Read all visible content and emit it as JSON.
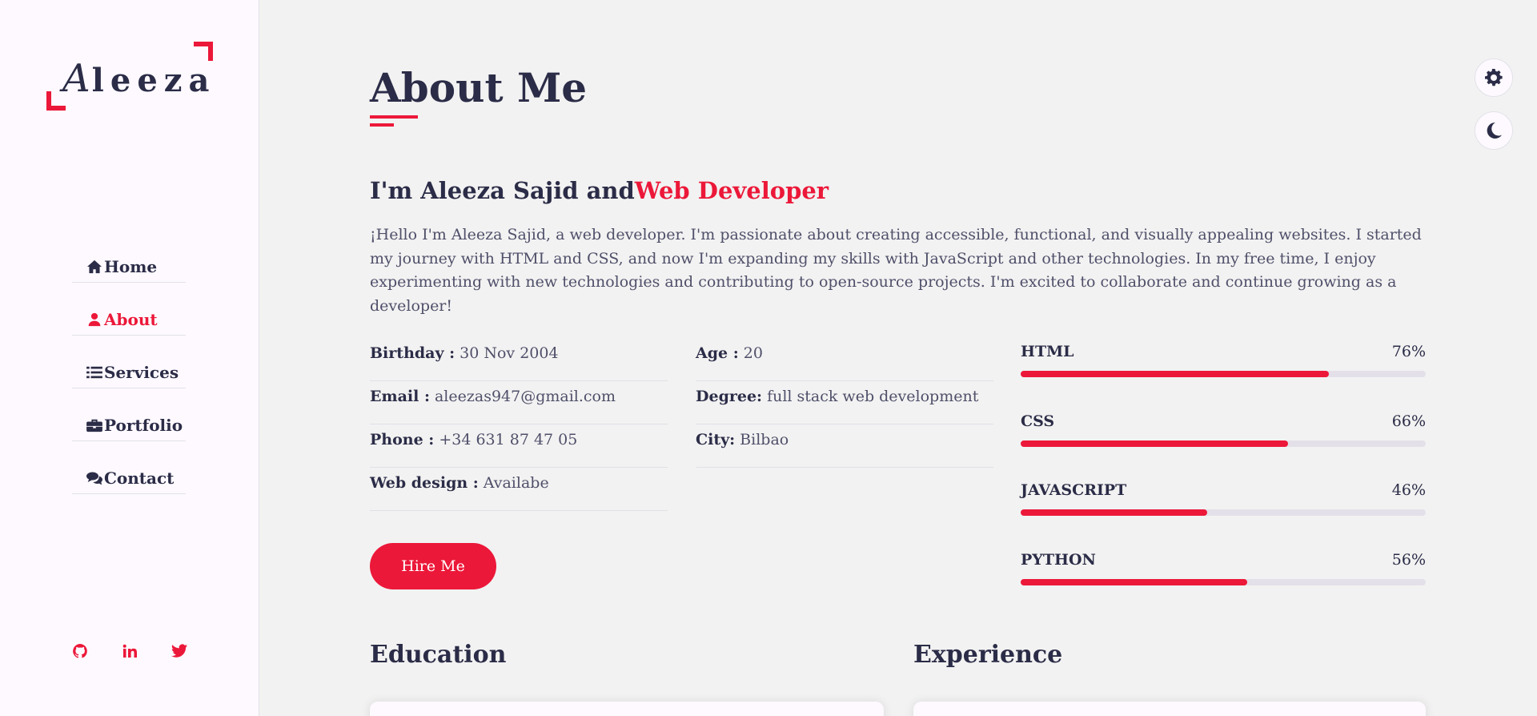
{
  "brand": {
    "logo_first": "A",
    "logo_rest": "leeza"
  },
  "nav": {
    "items": [
      {
        "label": "Home",
        "icon": "home-icon"
      },
      {
        "label": "About",
        "icon": "user-icon",
        "active": true
      },
      {
        "label": "Services",
        "icon": "list-icon"
      },
      {
        "label": "Portfolio",
        "icon": "briefcase-icon"
      },
      {
        "label": "Contact",
        "icon": "comments-icon"
      }
    ]
  },
  "socials": [
    "github-icon",
    "linkedin-icon",
    "twitter-icon"
  ],
  "toggles": [
    "gear-icon",
    "moon-icon"
  ],
  "about": {
    "title": "About Me",
    "heading_prefix": "I'm Aleeza Sajid and",
    "heading_accent": "Web Developer",
    "intro": "¡Hello I'm Aleeza Sajid, a web developer. I'm passionate about creating accessible, functional, and visually appealing websites. I started my journey with HTML and CSS, and now I'm expanding my skills with JavaScript and other technologies. In my free time, I enjoy experimenting with new technologies and contributing to open-source projects. I'm excited to collaborate and continue growing as a developer!",
    "info_left": [
      {
        "label": "Birthday :",
        "value": "30 Nov 2004"
      },
      {
        "label": "Email :",
        "value": "aleezas947@gmail.com"
      },
      {
        "label": "Phone :",
        "value": "+34 631 87 47 05"
      },
      {
        "label": "Web design :",
        "value": "Availabe"
      }
    ],
    "info_right": [
      {
        "label": "Age :",
        "value": "20"
      },
      {
        "label": "Degree:",
        "value": "full stack web development"
      },
      {
        "label": "City:",
        "value": "Bilbao"
      }
    ],
    "hire_label": "Hire Me",
    "skills": [
      {
        "name": "HTML",
        "percent_label": "76%",
        "value": 76
      },
      {
        "name": "CSS",
        "percent_label": "66%",
        "value": 66
      },
      {
        "name": "JAVASCRIPT",
        "percent_label": "46%",
        "value": 46
      },
      {
        "name": "PYTHON",
        "percent_label": "56%",
        "value": 56
      }
    ],
    "education_title": "Education",
    "experience_title": "Experience"
  },
  "colors": {
    "accent": "#ec1839",
    "text": "#2b2c47",
    "background": "#f2f2f2",
    "sidebar": "#fdf9ff"
  }
}
